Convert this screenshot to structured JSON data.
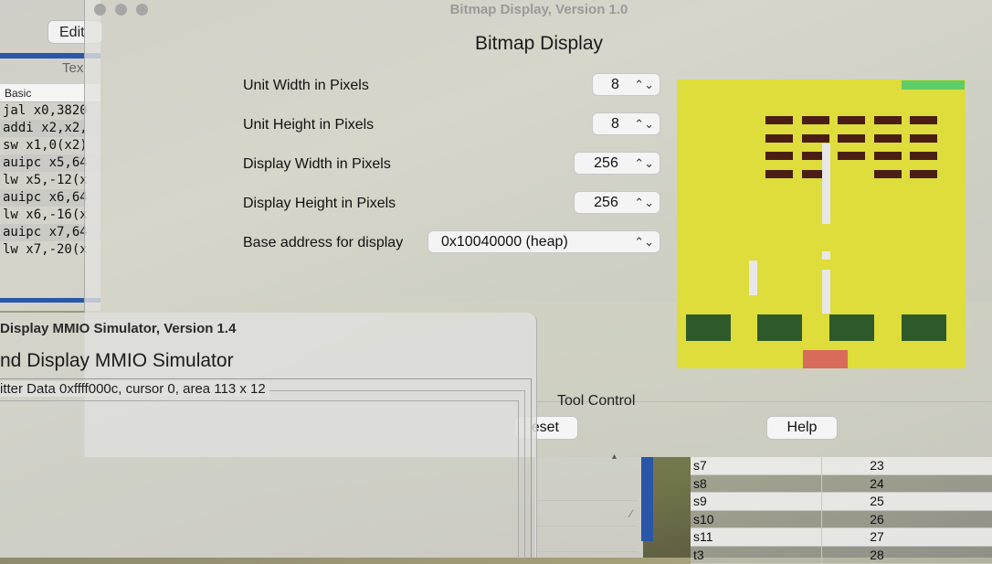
{
  "editor": {
    "edit_button": "Edit",
    "tab_label": "Tex",
    "code_header": "Basic",
    "code_lines": [
      "jal x0,3820",
      "addi x2,x2,",
      "sw x1,0(x2)",
      "auipc x5,64",
      "lw x5,-12(x",
      "auipc x6,64",
      "lw x6,-16(x",
      "auipc x7,64",
      "lw x7,-20(x"
    ]
  },
  "bitmap": {
    "window_title": "Bitmap Display, Version 1.0",
    "heading": "Bitmap Display",
    "settings": [
      {
        "label": "Unit Width in Pixels",
        "value": "8"
      },
      {
        "label": "Unit Height in Pixels",
        "value": "8"
      },
      {
        "label": "Display Width in Pixels",
        "value": "256"
      },
      {
        "label": "Display Height in Pixels",
        "value": "256"
      },
      {
        "label": "Base address for display",
        "value": "0x10040000 (heap)"
      }
    ],
    "tool_control_label": "Tool Control",
    "reset_label": "eset",
    "help_label": "Help",
    "colors": {
      "background": "#dedd3c",
      "brick": "#4a1e14",
      "green": "#2e7a34",
      "bar": "#5fcc6a",
      "paddle": "#d96b5a",
      "light": "#e8e8e8"
    }
  },
  "registers": [
    {
      "name": "s7",
      "num": "23"
    },
    {
      "name": "s8",
      "num": "24"
    },
    {
      "name": "s9",
      "num": "25"
    },
    {
      "name": "s10",
      "num": "26"
    },
    {
      "name": "s11",
      "num": "27"
    },
    {
      "name": "t3",
      "num": "28"
    }
  ],
  "mmio": {
    "window_title": "Display MMIO Simulator, Version 1.4",
    "heading": "nd Display MMIO Simulator",
    "group_label": "itter Data 0xffff000c, cursor 0, area 113 x 12"
  }
}
